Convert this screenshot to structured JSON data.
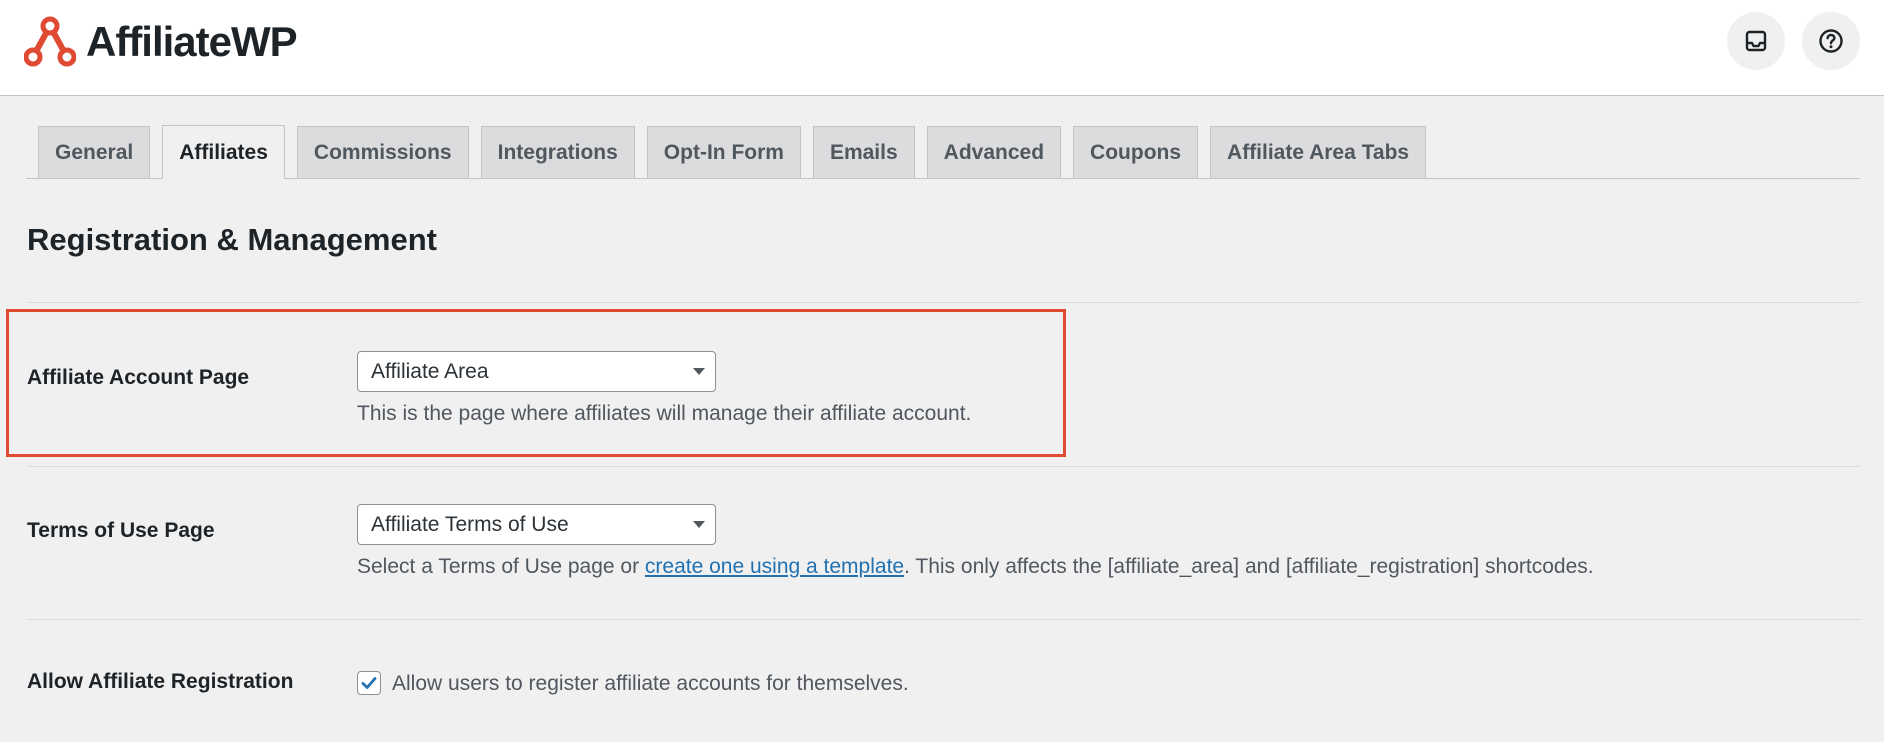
{
  "brand": {
    "name": "AffiliateWP"
  },
  "colors": {
    "accent": "#e04a33",
    "link": "#2271b1"
  },
  "header_icons": [
    "inbox-icon",
    "help-icon"
  ],
  "tabs": [
    {
      "label": "General",
      "active": false
    },
    {
      "label": "Affiliates",
      "active": true
    },
    {
      "label": "Commissions",
      "active": false
    },
    {
      "label": "Integrations",
      "active": false
    },
    {
      "label": "Opt-In Form",
      "active": false
    },
    {
      "label": "Emails",
      "active": false
    },
    {
      "label": "Advanced",
      "active": false
    },
    {
      "label": "Coupons",
      "active": false
    },
    {
      "label": "Affiliate Area Tabs",
      "active": false
    }
  ],
  "section": {
    "title": "Registration & Management"
  },
  "settings": {
    "account_page": {
      "label": "Affiliate Account Page",
      "selected": "Affiliate Area",
      "description": "This is the page where affiliates will manage their affiliate account."
    },
    "terms_page": {
      "label": "Terms of Use Page",
      "selected": "Affiliate Terms of Use",
      "description_before": "Select a Terms of Use page or ",
      "description_link": "create one using a template",
      "description_after": ". This only affects the [affiliate_area] and [affiliate_registration] shortcodes."
    },
    "registration": {
      "label": "Allow Affiliate Registration",
      "checked": true,
      "checkbox_label": "Allow users to register affiliate accounts for themselves."
    }
  }
}
